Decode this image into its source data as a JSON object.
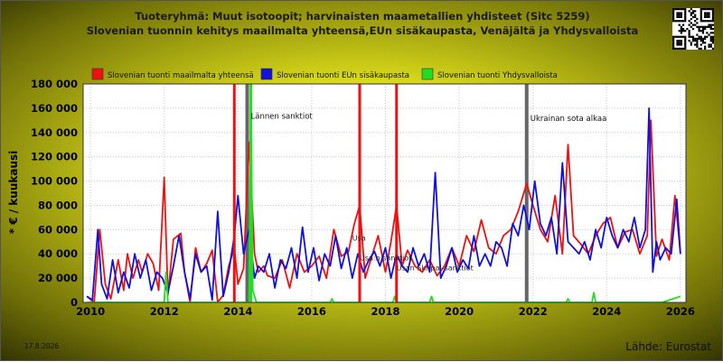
{
  "header": {
    "title_line1": "Tuoteryhmä: Muut isotoopit; harvinaisten maametallien yhdisteet (Sitc 5259)",
    "title_line2": "Slovenian tuonnin kehitys maailmalta yhteensä,EUn sisäkaupasta, Venäjältä ja Yhdysvalloista"
  },
  "footer": {
    "date": "17.8.2026",
    "source": "Lähde: Eurostat"
  },
  "colors": {
    "world": "#ee1111",
    "eu": "#1111dd",
    "usa": "#22dd22",
    "event_line": "#666666",
    "plot_bg": "#ffffff",
    "grid": "#c8c8c8"
  },
  "chart_data": {
    "type": "line",
    "ylabel": "* € / kuukausi",
    "xlabel": "",
    "xlim": [
      2009.8,
      2026.15
    ],
    "ylim": [
      0,
      180000
    ],
    "y_ticks": [
      0,
      20000,
      40000,
      60000,
      80000,
      100000,
      120000,
      140000,
      160000,
      180000
    ],
    "y_tick_labels": [
      "0",
      "20 000",
      "40 000",
      "60 000",
      "80 000",
      "100 000",
      "120 000",
      "140 000",
      "160 000",
      "180 000"
    ],
    "x_ticks": [
      2010,
      2012,
      2014,
      2016,
      2018,
      2020,
      2022,
      2024,
      2026
    ],
    "x_tick_labels": [
      "2010",
      "2012",
      "2014",
      "2016",
      "2018",
      "2020",
      "2022",
      "2024",
      "2026"
    ],
    "grid": "dotted",
    "legend_position": "top",
    "events": [
      {
        "label": "Lännen sanktiot",
        "date": 2014.25
      },
      {
        "label": "Ukrainan sota alkaa",
        "date": 2021.83
      }
    ],
    "annotations": [
      {
        "label": "Usa",
        "x": 2017.1,
        "y": 51000
      },
      {
        "label": "Usa:n sanktiot",
        "x": 2017.3,
        "y": 34500
      },
      {
        "label": "Usan Skripal-sanktiot",
        "x": 2018.3,
        "y": 26500
      }
    ],
    "spike_markers": [
      {
        "series": "Slovenian tuonti maailmalta yhteensä",
        "x": 2013.9
      },
      {
        "series": "Slovenian tuonti maailmalta yhteensä",
        "x": 2017.3
      },
      {
        "series": "Slovenian tuonti maailmalta yhteensä",
        "x": 2018.3
      },
      {
        "series": "Slovenian tuonti Yhdysvalloista",
        "x": 2014.35
      }
    ],
    "series": [
      {
        "name": "Slovenian tuonti maailmalta yhteensä",
        "x": [
          2009.9,
          2010.1,
          2010.25,
          2010.4,
          2010.55,
          2010.75,
          2010.9,
          2011.0,
          2011.15,
          2011.3,
          2011.4,
          2011.55,
          2011.7,
          2011.85,
          2012.0,
          2012.1,
          2012.25,
          2012.45,
          2012.55,
          2012.7,
          2012.85,
          2013.0,
          2013.15,
          2013.3,
          2013.45,
          2013.6,
          2013.75,
          2013.9,
          2014.0,
          2014.15,
          2014.3,
          2014.45,
          2014.55,
          2014.7,
          2014.8,
          2015.0,
          2015.2,
          2015.4,
          2015.6,
          2015.8,
          2016.0,
          2016.2,
          2016.4,
          2016.6,
          2016.8,
          2017.0,
          2017.15,
          2017.3,
          2017.45,
          2017.6,
          2017.8,
          2018.0,
          2018.15,
          2018.3,
          2018.45,
          2018.6,
          2018.8,
          2019.0,
          2019.2,
          2019.4,
          2019.6,
          2019.8,
          2020.0,
          2020.2,
          2020.4,
          2020.6,
          2020.8,
          2021.0,
          2021.2,
          2021.4,
          2021.6,
          2021.83,
          2022.0,
          2022.2,
          2022.4,
          2022.6,
          2022.8,
          2022.95,
          2023.1,
          2023.3,
          2023.5,
          2023.7,
          2023.9,
          2024.1,
          2024.3,
          2024.5,
          2024.7,
          2024.9,
          2025.1,
          2025.2,
          2025.35,
          2025.5,
          2025.7,
          2025.85,
          2026.0
        ],
        "values": [
          5000,
          0,
          60000,
          15000,
          3000,
          35000,
          10000,
          40000,
          20000,
          35000,
          25000,
          40000,
          32000,
          10000,
          103000,
          6000,
          52000,
          57000,
          25000,
          0,
          45000,
          25000,
          32000,
          43000,
          0,
          6000,
          30000,
          45000,
          15000,
          28000,
          132000,
          40000,
          25000,
          30000,
          22000,
          20000,
          35000,
          12000,
          40000,
          25000,
          30000,
          38000,
          20000,
          60000,
          38000,
          42000,
          64000,
          80000,
          20000,
          35000,
          55000,
          25000,
          50000,
          80000,
          30000,
          43000,
          30000,
          25000,
          35000,
          22000,
          30000,
          45000,
          30000,
          55000,
          42000,
          68000,
          45000,
          40000,
          55000,
          60000,
          75000,
          98000,
          80000,
          60000,
          50000,
          88000,
          40000,
          130000,
          55000,
          48000,
          40000,
          55000,
          65000,
          70000,
          45000,
          58000,
          60000,
          40000,
          55000,
          150000,
          38000,
          52000,
          35000,
          88000,
          40000
        ]
      },
      {
        "name": "Slovenian tuonti EUn sisäkaupasta",
        "x": [
          2009.9,
          2010.05,
          2010.2,
          2010.3,
          2010.45,
          2010.6,
          2010.75,
          2010.9,
          2011.05,
          2011.2,
          2011.35,
          2011.5,
          2011.65,
          2011.8,
          2011.95,
          2012.1,
          2012.25,
          2012.4,
          2012.55,
          2012.7,
          2012.85,
          2013.0,
          2013.15,
          2013.3,
          2013.45,
          2013.6,
          2013.75,
          2013.9,
          2014.0,
          2014.15,
          2014.3,
          2014.45,
          2014.55,
          2014.7,
          2014.85,
          2015.0,
          2015.15,
          2015.3,
          2015.45,
          2015.6,
          2015.75,
          2015.9,
          2016.05,
          2016.2,
          2016.35,
          2016.5,
          2016.65,
          2016.8,
          2016.95,
          2017.1,
          2017.25,
          2017.4,
          2017.55,
          2017.7,
          2017.85,
          2018.0,
          2018.15,
          2018.3,
          2018.45,
          2018.6,
          2018.75,
          2018.9,
          2019.05,
          2019.2,
          2019.35,
          2019.5,
          2019.65,
          2019.8,
          2019.95,
          2020.1,
          2020.25,
          2020.4,
          2020.55,
          2020.7,
          2020.85,
          2021.0,
          2021.15,
          2021.3,
          2021.45,
          2021.6,
          2021.75,
          2021.9,
          2022.05,
          2022.2,
          2022.35,
          2022.5,
          2022.65,
          2022.8,
          2022.95,
          2023.1,
          2023.25,
          2023.4,
          2023.55,
          2023.7,
          2023.85,
          2024.0,
          2024.15,
          2024.3,
          2024.45,
          2024.6,
          2024.75,
          2024.9,
          2025.05,
          2025.15,
          2025.25,
          2025.35,
          2025.45,
          2025.6,
          2025.75,
          2025.9,
          2026.0
        ],
        "values": [
          5000,
          2000,
          60000,
          15000,
          3000,
          35000,
          8000,
          25000,
          12000,
          40000,
          20000,
          35000,
          10000,
          25000,
          20000,
          8000,
          30000,
          55000,
          25000,
          3000,
          40000,
          25000,
          30000,
          2000,
          75000,
          5000,
          25000,
          55000,
          88000,
          40000,
          60000,
          20000,
          30000,
          25000,
          40000,
          12000,
          35000,
          28000,
          45000,
          20000,
          62000,
          25000,
          45000,
          18000,
          40000,
          30000,
          55000,
          28000,
          45000,
          20000,
          40000,
          25000,
          35000,
          42000,
          30000,
          45000,
          20000,
          40000,
          30000,
          25000,
          45000,
          30000,
          40000,
          25000,
          107000,
          20000,
          30000,
          45000,
          25000,
          35000,
          28000,
          55000,
          30000,
          40000,
          30000,
          50000,
          45000,
          30000,
          65000,
          55000,
          80000,
          60000,
          100000,
          65000,
          55000,
          70000,
          40000,
          115000,
          50000,
          45000,
          40000,
          50000,
          35000,
          60000,
          45000,
          70000,
          55000,
          45000,
          60000,
          50000,
          70000,
          45000,
          60000,
          160000,
          25000,
          50000,
          35000,
          45000,
          40000,
          85000,
          40000
        ]
      },
      {
        "name": "Slovenian tuonti Yhdysvalloista",
        "x": [
          2009.9,
          2012.0,
          2012.05,
          2012.1,
          2013.5,
          2014.3,
          2014.35,
          2014.4,
          2014.5,
          2016.0,
          2016.5,
          2016.55,
          2016.6,
          2018.2,
          2018.25,
          2018.3,
          2019.2,
          2019.25,
          2019.3,
          2022.9,
          2022.95,
          2023.0,
          2023.6,
          2023.65,
          2023.7,
          2025.5,
          2025.8,
          2026.0
        ],
        "values": [
          0,
          0,
          25000,
          0,
          0,
          0,
          180000,
          10000,
          0,
          0,
          0,
          3000,
          0,
          0,
          5000,
          0,
          0,
          5000,
          0,
          0,
          3000,
          0,
          0,
          8000,
          0,
          0,
          3000,
          5000
        ]
      }
    ]
  }
}
